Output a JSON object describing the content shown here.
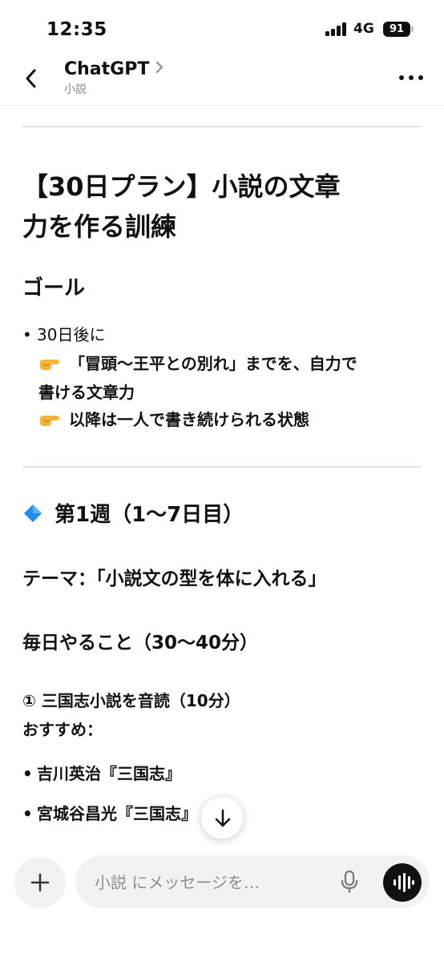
{
  "status": {
    "time": "12:35",
    "network": "4G",
    "battery": "91"
  },
  "header": {
    "title": "ChatGPT",
    "subtitle": "小説"
  },
  "content": {
    "heading": "【30日プラン】小説の文章力を作る訓練",
    "goal_heading": "ゴール",
    "goal_bullet": "30日後に",
    "goal_points": [
      "「冒頭〜王平との別れ」までを、自力で",
      "書ける文章力",
      "以降は一人で書き続けられる状態"
    ],
    "week_heading": "第1週（1〜7日目）",
    "theme": "テーマ：「小説文の型を体に入れる」",
    "daily": "毎日やること（30〜40分）",
    "task1": "① 三国志小説を音読（10分）",
    "recommend": "おすすめ：",
    "books": [
      "吉川英治『三国志』",
      "宮城谷昌光『三国志』"
    ]
  },
  "composer": {
    "placeholder": "小説 にメッセージを…"
  },
  "icons": {
    "back": "chevron-left-icon",
    "title_chevron": "chevron-right-icon",
    "more": "more-horizontal-icon",
    "hand": "pointing-hand-icon",
    "diamond": "blue-diamond-icon",
    "scroll": "arrow-down-icon",
    "plus": "plus-icon",
    "mic": "microphone-icon",
    "voice": "voice-waveform-icon"
  },
  "colors": {
    "accent": "#1f8ef1",
    "hand": "#f5b53c"
  }
}
